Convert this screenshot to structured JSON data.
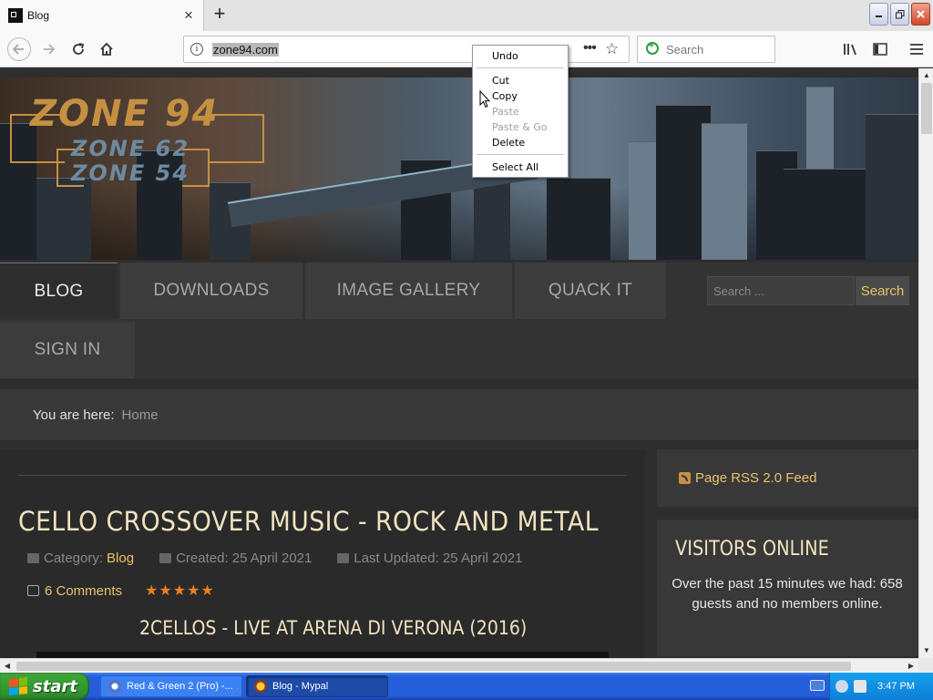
{
  "browser": {
    "tab_title": "Blog",
    "new_tab_symbol": "+",
    "close_symbol": "×",
    "url": "zone94.com",
    "search_placeholder": "Search"
  },
  "site": {
    "logo_main": "ZONE 94",
    "logo_sub1": "ZONE 62",
    "logo_sub2": "ZONE 54",
    "menu": {
      "blog": "BLOG",
      "downloads": "DOWNLOADS",
      "gallery": "IMAGE GALLERY",
      "quack": "QUACK IT",
      "signin": "SIGN IN"
    },
    "search_placeholder": "Search ...",
    "search_button": "Search",
    "breadcrumb": {
      "label": "You are here:",
      "home": "Home"
    }
  },
  "article": {
    "title": "CELLO CROSSOVER MUSIC - ROCK AND METAL",
    "category_label": "Category:",
    "category_link": "Blog",
    "created": "Created: 25 April 2021",
    "updated": "Last Updated: 25 April 2021",
    "comments": "6 Comments",
    "stars": "★★★★★",
    "rating": 5,
    "subtitle": "2CELLOS - LIVE AT ARENA DI VERONA (2016)"
  },
  "sidebar": {
    "rss": "Page RSS 2.0 Feed",
    "visitors_title": "VISITORS ONLINE",
    "visitors_text": "Over the past 15 minutes we had: 658 guests and no members online."
  },
  "context_menu": {
    "undo": "Undo",
    "cut": "Cut",
    "copy": "Copy",
    "paste": "Paste",
    "paste_go": "Paste & Go",
    "delete": "Delete",
    "select_all": "Select All"
  },
  "taskbar": {
    "start": "start",
    "task_chrome": "Red & Green 2 (Pro) -...",
    "task_blog": "Blog - Mypal",
    "clock": "3:47 PM"
  },
  "colors": {
    "accent_gold": "#e7c46a",
    "title_cream": "#f0e3c0",
    "star_orange": "#e8821e"
  }
}
